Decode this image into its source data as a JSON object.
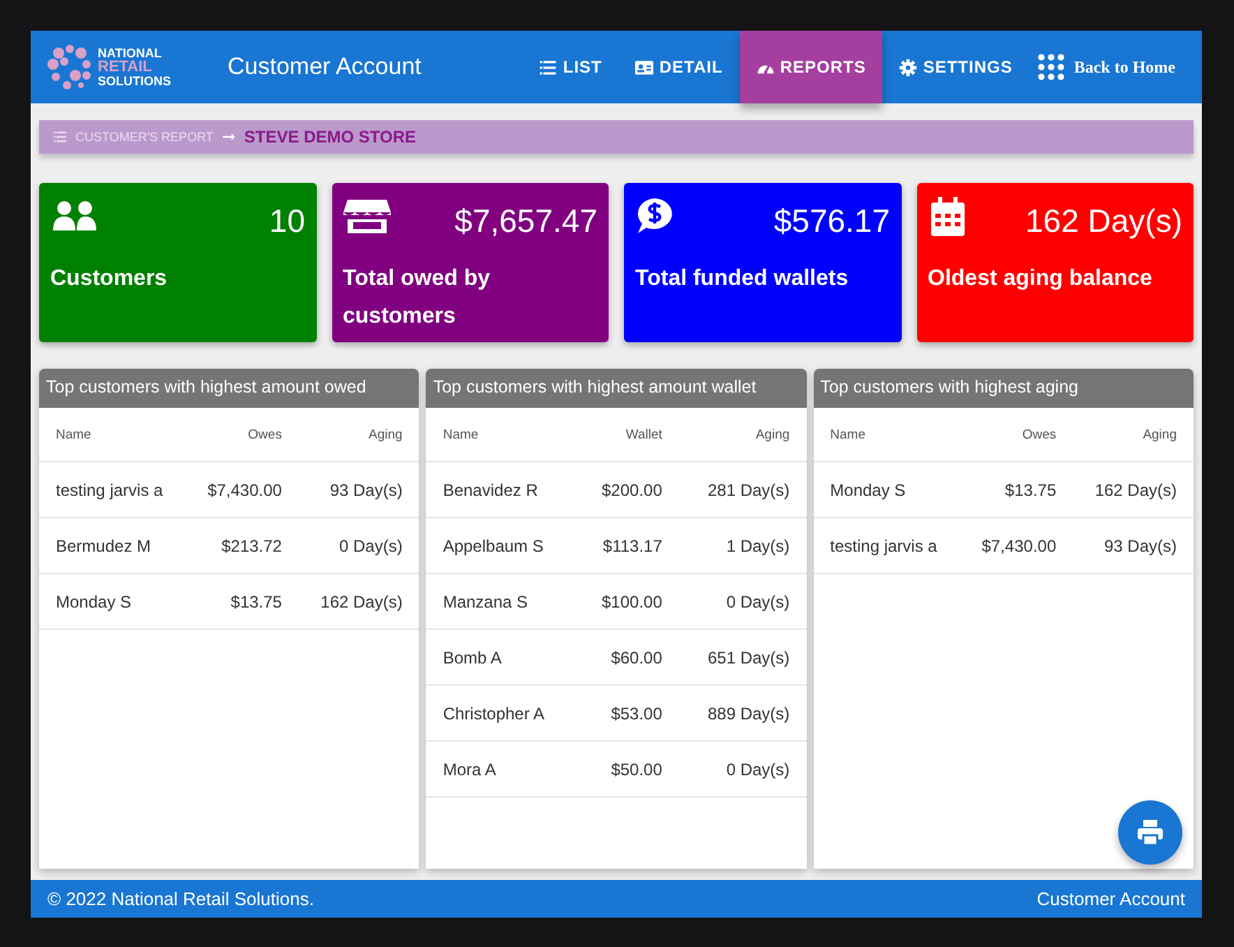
{
  "header": {
    "logo_lines": [
      "NATIONAL",
      "RETAIL",
      "SOLUTIONS"
    ],
    "title": "Customer Account",
    "nav": [
      {
        "label": "LIST",
        "selected": false
      },
      {
        "label": "DETAIL",
        "selected": false
      },
      {
        "label": "REPORTS",
        "selected": true
      },
      {
        "label": "SETTINGS",
        "selected": false
      }
    ],
    "home_link": "Back to Home"
  },
  "breadcrumb": {
    "parent": "CUSTOMER'S REPORT",
    "current": "STEVE DEMO STORE"
  },
  "stats": [
    {
      "value": "10",
      "label": "Customers",
      "color": "#008000"
    },
    {
      "value": "$7,657.47",
      "label": "Total owed by customers",
      "color": "#800080"
    },
    {
      "value": "$576.17",
      "label": "Total funded wallets",
      "color": "#0000ff"
    },
    {
      "value": "162 Day(s)",
      "label": "Oldest aging balance",
      "color": "#ff0000"
    }
  ],
  "tables": [
    {
      "title": "Top customers with highest amount owed",
      "columns": [
        "Name",
        "Owes",
        "Aging"
      ],
      "rows": [
        [
          "testing jarvis a",
          "$7,430.00",
          "93 Day(s)"
        ],
        [
          "Bermudez M",
          "$213.72",
          "0 Day(s)"
        ],
        [
          "Monday S",
          "$13.75",
          "162 Day(s)"
        ]
      ]
    },
    {
      "title": "Top customers with highest amount wallet",
      "columns": [
        "Name",
        "Wallet",
        "Aging"
      ],
      "rows": [
        [
          "Benavidez R",
          "$200.00",
          "281 Day(s)"
        ],
        [
          "Appelbaum S",
          "$113.17",
          "1 Day(s)"
        ],
        [
          "Manzana S",
          "$100.00",
          "0 Day(s)"
        ],
        [
          "Bomb A",
          "$60.00",
          "651 Day(s)"
        ],
        [
          "Christopher A",
          "$53.00",
          "889 Day(s)"
        ],
        [
          "Mora A",
          "$50.00",
          "0 Day(s)"
        ]
      ]
    },
    {
      "title": "Top customers with highest aging",
      "columns": [
        "Name",
        "Owes",
        "Aging"
      ],
      "rows": [
        [
          "Monday S",
          "$13.75",
          "162 Day(s)"
        ],
        [
          "testing jarvis a",
          "$7,430.00",
          "93 Day(s)"
        ]
      ]
    }
  ],
  "footer": {
    "copyright": "© 2022 National Retail Solutions.",
    "right": "Customer Account"
  }
}
